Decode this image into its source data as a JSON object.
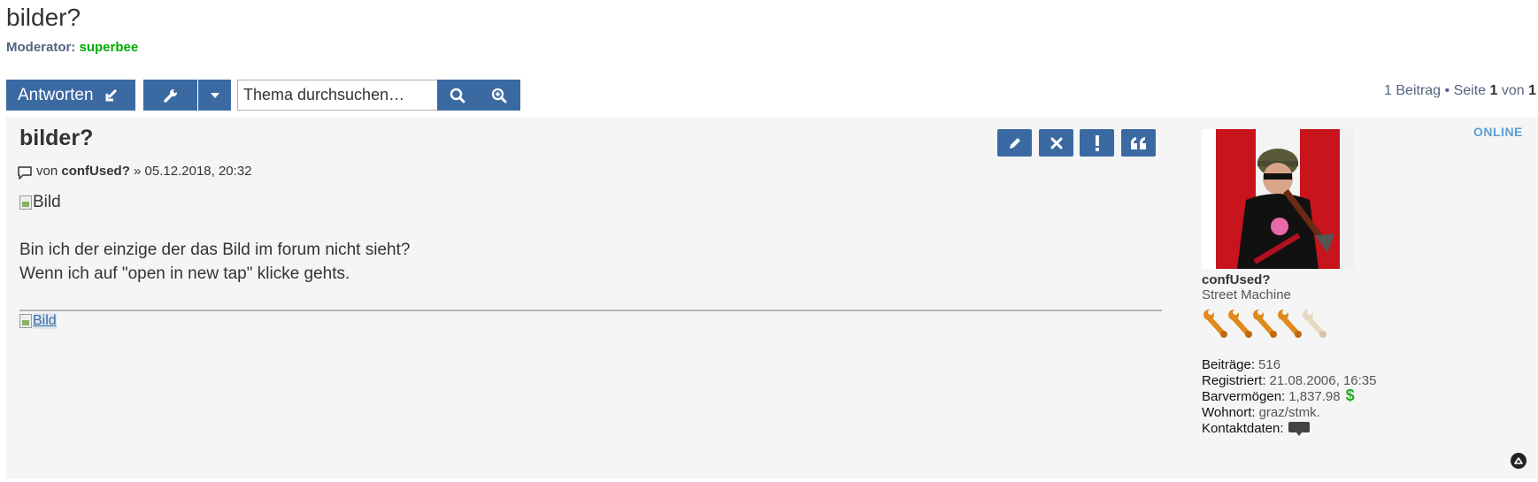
{
  "topic": {
    "title": "bilder?",
    "moderator_label": "Moderator:",
    "moderator_name": "superbee"
  },
  "toolbar": {
    "reply_label": "Antworten",
    "search_placeholder": "Thema durchsuchen…",
    "pagination": {
      "prefix": "1 Beitrag • Seite",
      "current": "1",
      "of": "von",
      "total": "1"
    }
  },
  "post": {
    "title": "bilder?",
    "by_label": "von",
    "author": "confUsed?",
    "date": "» 05.12.2018, 20:32",
    "image_alt": "Bild",
    "text_lines": [
      "Bin ich der einzige der das Bild im forum nicht sieht?",
      "Wenn ich auf \"open in new tap\" klicke gehts."
    ],
    "signature_image_alt": "Bild"
  },
  "profile": {
    "status": "ONLINE",
    "username": "confUsed?",
    "rank": "Street Machine",
    "rank_icon_count": 5,
    "rank_icons_filled": 4,
    "fields": [
      {
        "label": "Beiträge:",
        "value": "516"
      },
      {
        "label": "Registriert:",
        "value": "21.08.2006, 16:35"
      },
      {
        "label": "Barvermögen:",
        "value": "1,837.98"
      },
      {
        "label": "Wohnort:",
        "value": "graz/stmk."
      },
      {
        "label": "Kontaktdaten:",
        "value": ""
      }
    ],
    "currency_symbol": "$"
  },
  "colors": {
    "button_blue": "#3b6aa3",
    "moderator_green": "#00aa00",
    "online_blue": "#5a9ed6",
    "post_background": "#f5f5f5"
  },
  "icons": {
    "reply": "reply-arrow-icon",
    "tools": "wrench-icon",
    "caret": "caret-down-icon",
    "search": "search-icon",
    "advanced_search": "zoom-in-icon",
    "edit": "pencil-icon",
    "delete": "close-icon",
    "report": "exclamation-icon",
    "quote": "quote-icon",
    "contact": "chat-bubble-icon",
    "back_to_top": "arrow-up-icon"
  }
}
